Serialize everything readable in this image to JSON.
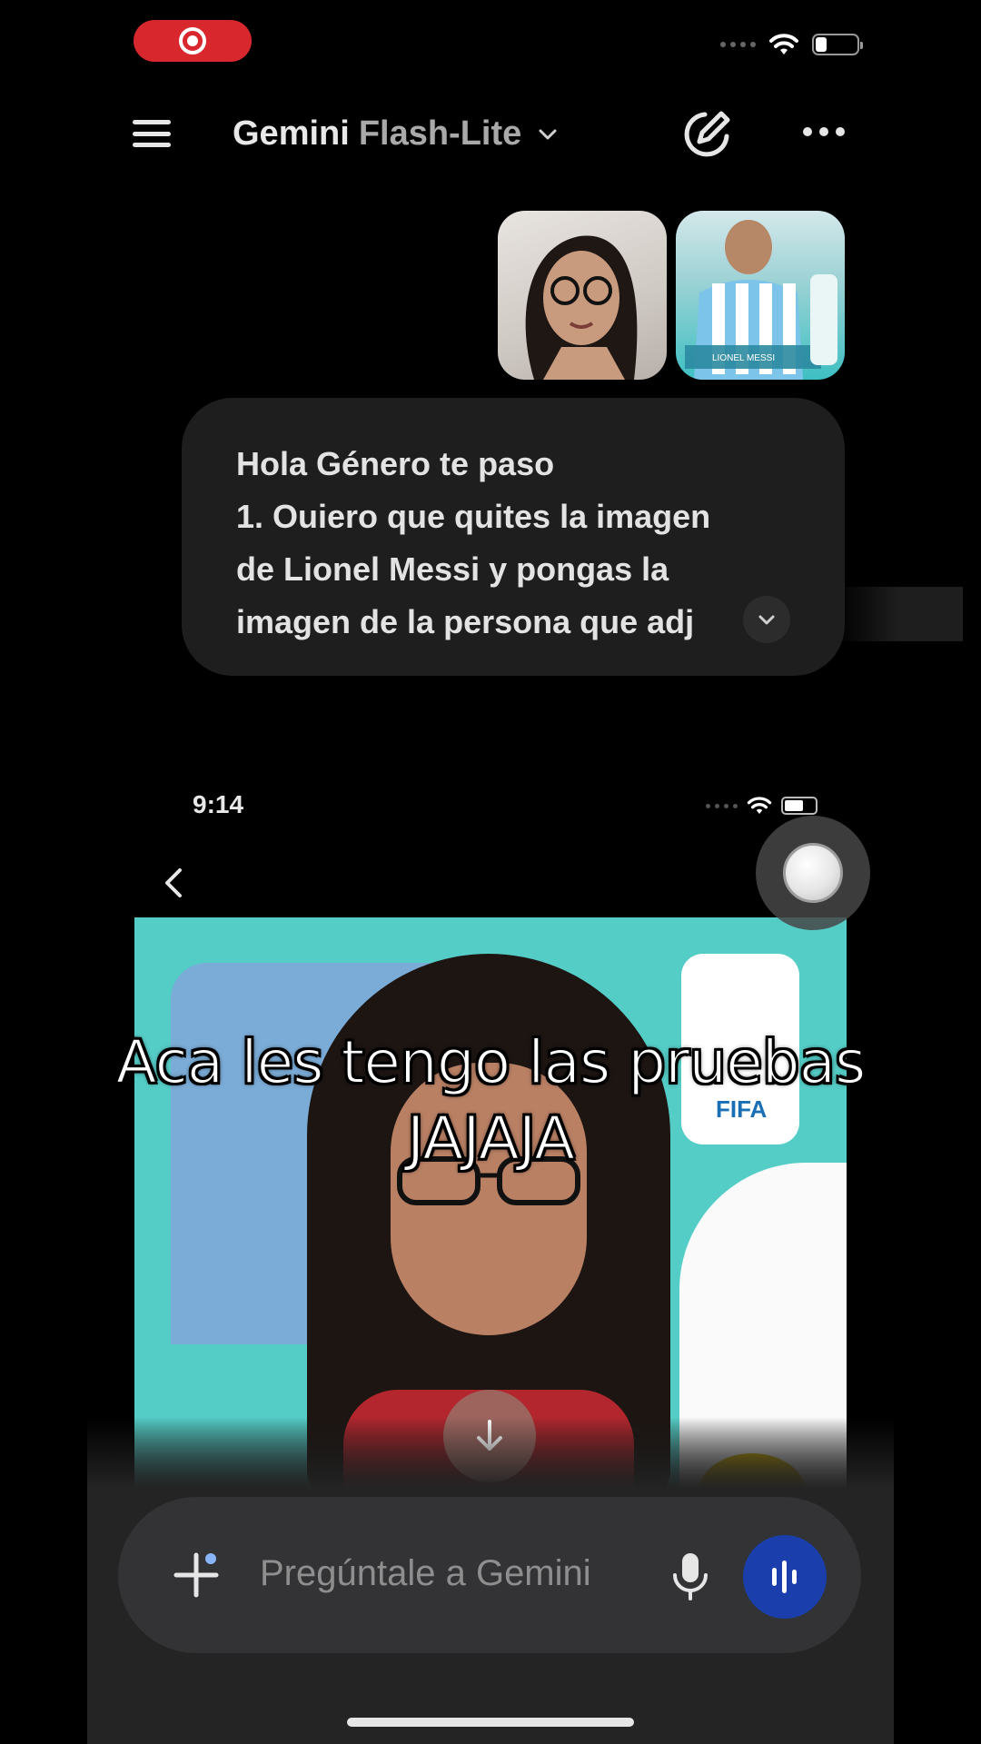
{
  "header": {
    "title_main": "Gemini",
    "title_sub": "Flash-Lite"
  },
  "thumbnails": [
    {
      "name": "attached-photo-woman"
    },
    {
      "name": "attached-photo-messi-card",
      "label": "LIONEL MESSI"
    }
  ],
  "message": {
    "lines": [
      "Hola Género te paso",
      "1. Ouiero que quites la imagen",
      "de Lionel Messi y pongas la",
      "imagen de la persona que adj"
    ]
  },
  "embedded": {
    "time": "9:14",
    "fifa": "FIFA"
  },
  "caption": {
    "line1": "Aca les tengo las pruebas",
    "line2": "JAJAJA"
  },
  "input": {
    "placeholder": "Pregúntale a Gemini"
  },
  "colors": {
    "background": "#000000",
    "bubble": "#1e1e1f",
    "input_bar": "#333335",
    "live_button": "#1a3fad",
    "record_pill": "#d9272e",
    "card_teal": "#55cdc7"
  }
}
